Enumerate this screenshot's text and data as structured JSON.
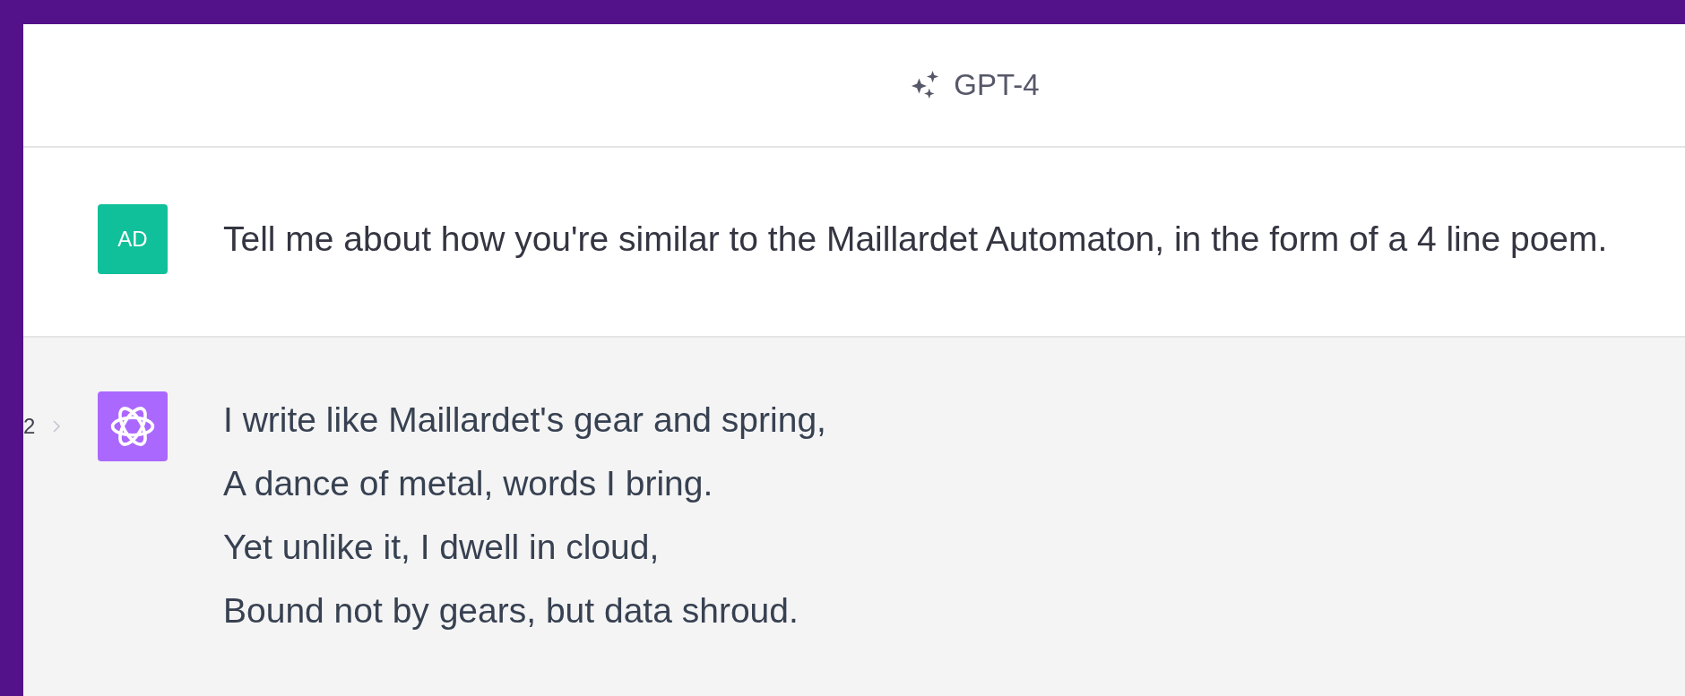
{
  "header": {
    "model": "GPT-4"
  },
  "messages": [
    {
      "kind": "user",
      "avatar": "AD",
      "lines": [
        "Tell me about how you're similar to the Maillardet Automaton, in the form of a 4 line poem."
      ]
    },
    {
      "kind": "assistant",
      "pager": "2",
      "lines": [
        "I write like Maillardet's gear and spring,",
        "A dance of metal, words I bring.",
        "Yet unlike it, I dwell in cloud,",
        "Bound not by gears, but data shroud."
      ]
    }
  ]
}
